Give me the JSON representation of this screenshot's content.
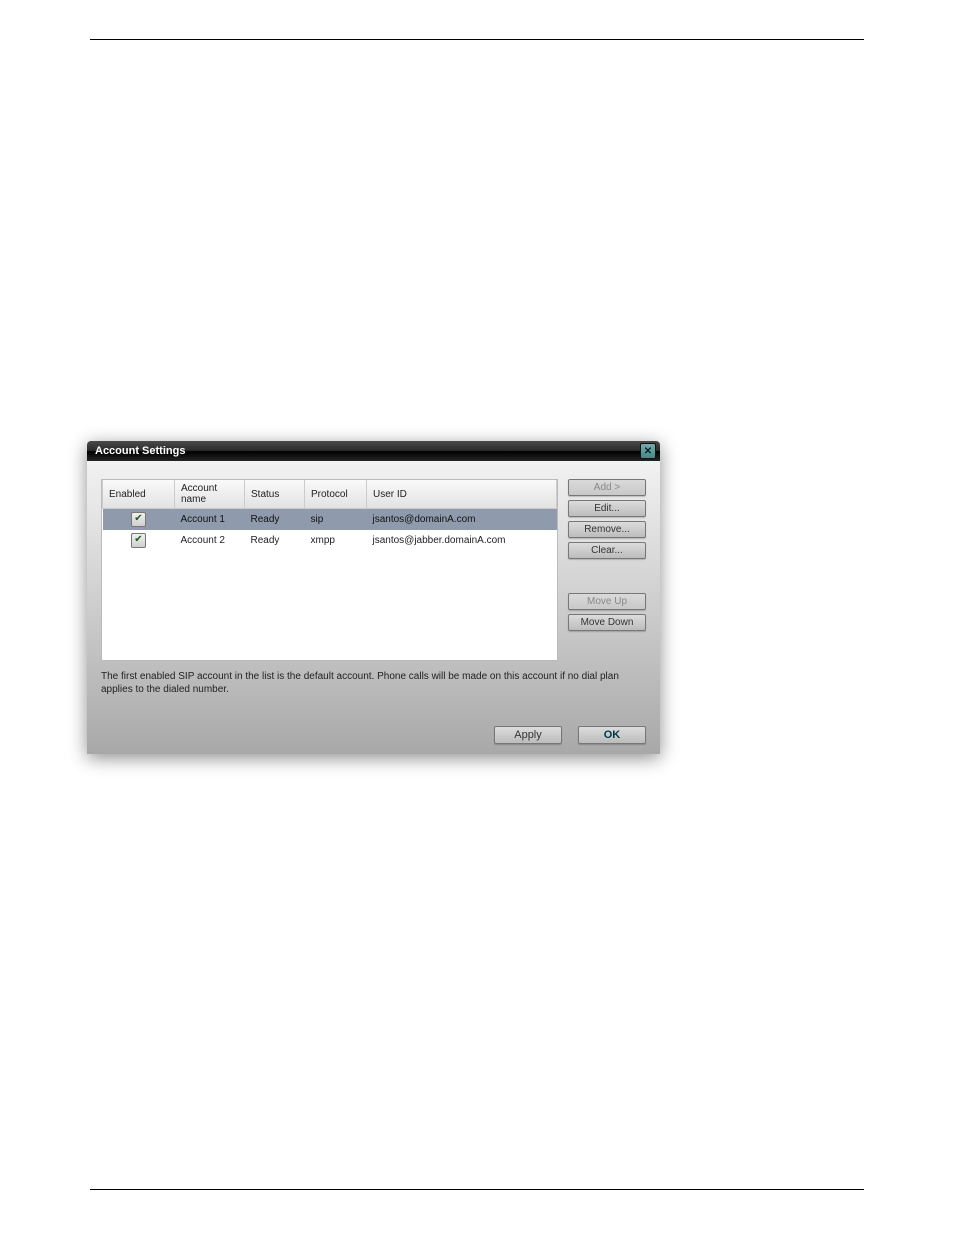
{
  "dialog": {
    "title": "Account Settings",
    "close_glyph": "✕",
    "columns": {
      "enabled": "Enabled",
      "account_name": "Account name",
      "status": "Status",
      "protocol": "Protocol",
      "user_id": "User ID"
    },
    "rows": [
      {
        "enabled_glyph": "✔",
        "account_name": "Account 1",
        "status": "Ready",
        "protocol": "sip",
        "user_id": "jsantos@domainA.com",
        "selected": true
      },
      {
        "enabled_glyph": "✔",
        "account_name": "Account 2",
        "status": "Ready",
        "protocol": "xmpp",
        "user_id": "jsantos@jabber.domainA.com",
        "selected": false
      }
    ],
    "buttons": {
      "add": "Add >",
      "edit": "Edit...",
      "remove": "Remove...",
      "clear": "Clear...",
      "move_up": "Move Up",
      "move_down": "Move Down"
    },
    "hint": "The first enabled SIP account in the list is the default account. Phone calls will be made on this account if no dial plan applies to the dialed number.",
    "footer": {
      "apply": "Apply",
      "ok": "OK"
    }
  }
}
